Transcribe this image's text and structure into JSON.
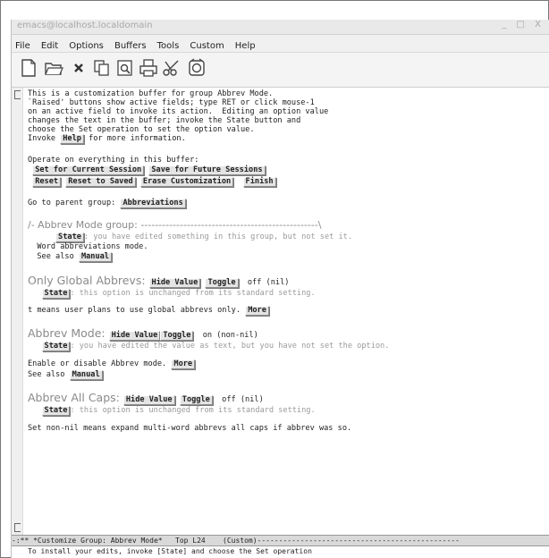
{
  "window": {
    "title": "emacs@localhost.localdomain",
    "controls": "_ □ X"
  },
  "menu": [
    "File",
    "Edit",
    "Options",
    "Buffers",
    "Tools",
    "Custom",
    "Help"
  ],
  "toolbar_icons": [
    "new-file-icon",
    "open-folder-icon",
    "close-x-icon",
    "copy-icon",
    "find-icon",
    "print-icon",
    "cut-scissors-icon",
    "info-icon"
  ],
  "intro": {
    "l1": "This is a customization buffer for group Abbrev Mode.",
    "l2": "`Raised' buttons show active fields; type RET or click mouse-1",
    "l3": "on an active field to invoke its action.  Editing an option value",
    "l4": "changes the text in the buffer; invoke the State button and",
    "l5": "choose the Set operation to set the option value.",
    "l6a": "Invoke ",
    "help": "Help",
    "l6b": " for more information."
  },
  "operate": {
    "label": "Operate on everything in this buffer:",
    "set_current": "Set for Current Session",
    "save_future": "Save for Future Sessions",
    "reset": "Reset",
    "reset_saved": "Reset to Saved",
    "erase": "Erase Customization",
    "finish": "Finish"
  },
  "parent": {
    "label": "Go to parent group: ",
    "link": "Abbreviations"
  },
  "group": {
    "header": "/- Abbrev Mode group: --------------------------------------------------\\",
    "state": "State",
    "state_text": ": you have edited something in this group, but not set it.",
    "doc": "Word abbreviations mode.",
    "see_also": "See also ",
    "manual": "Manual"
  },
  "opt1": {
    "tag": "Only Global Abbrevs: ",
    "hide": "Hide Value",
    "toggle": "Toggle",
    "value": "  off (nil)",
    "state": "State",
    "state_text": ": this option is unchanged from its standard setting.",
    "doc": "t means user plans to use global abbrevs only. ",
    "more": "More"
  },
  "opt2": {
    "tag": "Abbrev Mode: ",
    "hide": "Hide Value",
    "toggle": "Toggle",
    "value": "  on (non-nil)",
    "state": "State",
    "state_text": ": you have edited the value as text, but you have not set the option.",
    "doc": "Enable or disable Abbrev mode. ",
    "more": "More",
    "see_also": "See also ",
    "manual": "Manual"
  },
  "opt3": {
    "tag": "Abbrev All Caps: ",
    "hide": "Hide Value",
    "toggle": "Toggle",
    "value": "  off (nil)",
    "state": "State",
    "state_text": ": this option is unchanged from its standard setting.",
    "doc": "Set non-nil means expand multi-word abbrevs all caps if abbrev was so."
  },
  "modeline": "-:** *Customize Group: Abbrev Mode*   Top L24    (Custom)-----------------------------------------------",
  "echo": "To install your edits, invoke [State] and choose the Set operation"
}
